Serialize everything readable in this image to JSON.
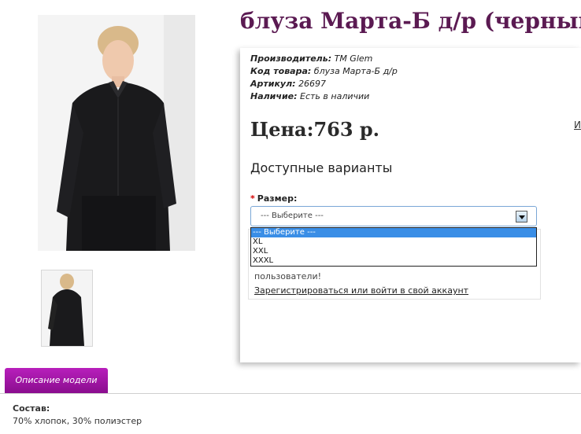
{
  "product": {
    "title": "блуза Марта-Б д/р (черный)",
    "manufacturer_label": "Производитель:",
    "manufacturer_value": "ТМ Glem",
    "code_label": "Код товара:",
    "code_value": "блуза Марта-Б д/р",
    "article_label": "Артикул:",
    "article_value": "26697",
    "availability_label": "Наличие:",
    "availability_value": "Есть в наличии",
    "price_label": "Цена:",
    "price_value": "763 р."
  },
  "side_link": "И",
  "options": {
    "title": "Доступные варианты",
    "required_mark": "*",
    "size_label": "Размер:",
    "selected": "--- Выберите ---",
    "dropdown": [
      "--- Выберите ---",
      "XL",
      "XXL",
      "XXXL"
    ]
  },
  "notice": {
    "text": "пользователи!",
    "link": "Зарегистрироваться или войти в свой аккаунт"
  },
  "tabs": {
    "description_label": "Описание модели",
    "composition_label": "Состав:",
    "composition_value": "70% хлопок, 30% полиэстер"
  },
  "colors": {
    "title": "#5b1a52",
    "tab": "#a316a7",
    "dropdown_highlight": "#3a8ee6"
  }
}
